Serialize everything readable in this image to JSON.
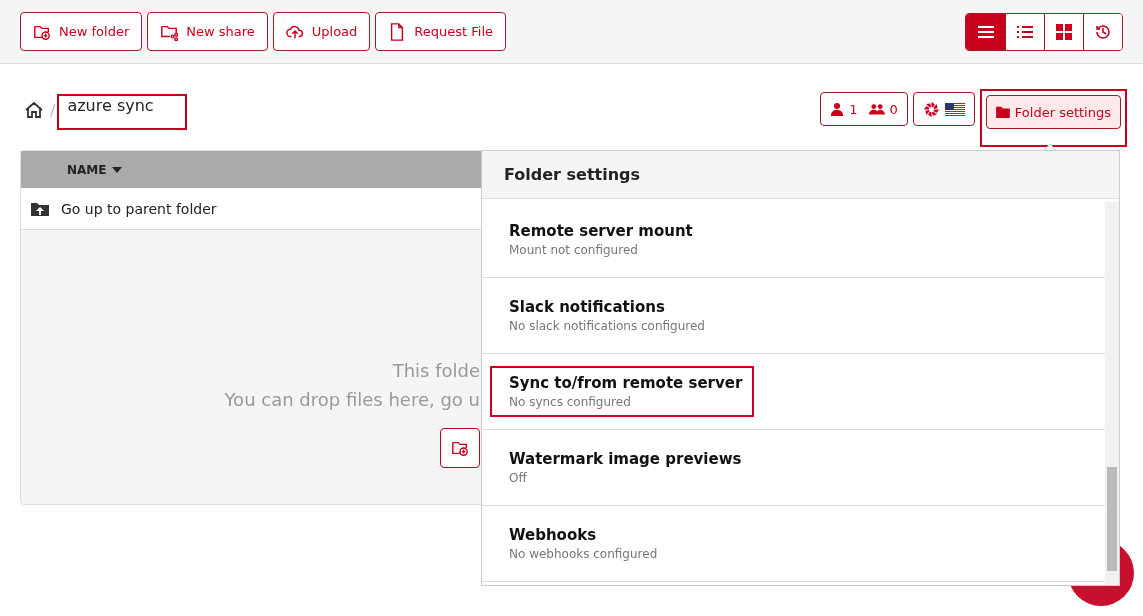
{
  "toolbar": {
    "buttons": [
      {
        "kind": "new-folder",
        "label": "New folder"
      },
      {
        "kind": "new-share",
        "label": "New share"
      },
      {
        "kind": "upload",
        "label": "Upload"
      },
      {
        "kind": "request",
        "label": "Request File"
      }
    ],
    "views": [
      {
        "kind": "lines",
        "selected": true
      },
      {
        "kind": "list",
        "selected": false
      },
      {
        "kind": "grid",
        "selected": false
      },
      {
        "kind": "history",
        "selected": false
      }
    ]
  },
  "breadcrumb": {
    "separator": "/",
    "current": "azure sync",
    "highlighted": true
  },
  "users": {
    "users": "1",
    "groups": "0"
  },
  "folder_settings_button": {
    "label": "Folder settings",
    "highlighted": true
  },
  "table": {
    "columns": [
      {
        "label": "NAME",
        "sorted": true
      }
    ],
    "parent_row": "Go up to parent folder",
    "empty_lines": [
      "This folde",
      "You can drop files here, go u"
    ]
  },
  "popover": {
    "title": "Folder settings",
    "items": [
      {
        "title": "Remote server mount",
        "subtitle": "Mount not configured",
        "highlighted": false
      },
      {
        "title": "Slack notifications",
        "subtitle": "No slack notifications configured",
        "highlighted": false
      },
      {
        "title": "Sync to/from remote server",
        "subtitle": "No syncs configured",
        "highlighted": true
      },
      {
        "title": "Watermark image previews",
        "subtitle": "Off",
        "highlighted": false
      },
      {
        "title": "Webhooks",
        "subtitle": "No webhooks configured",
        "highlighted": false
      }
    ]
  }
}
